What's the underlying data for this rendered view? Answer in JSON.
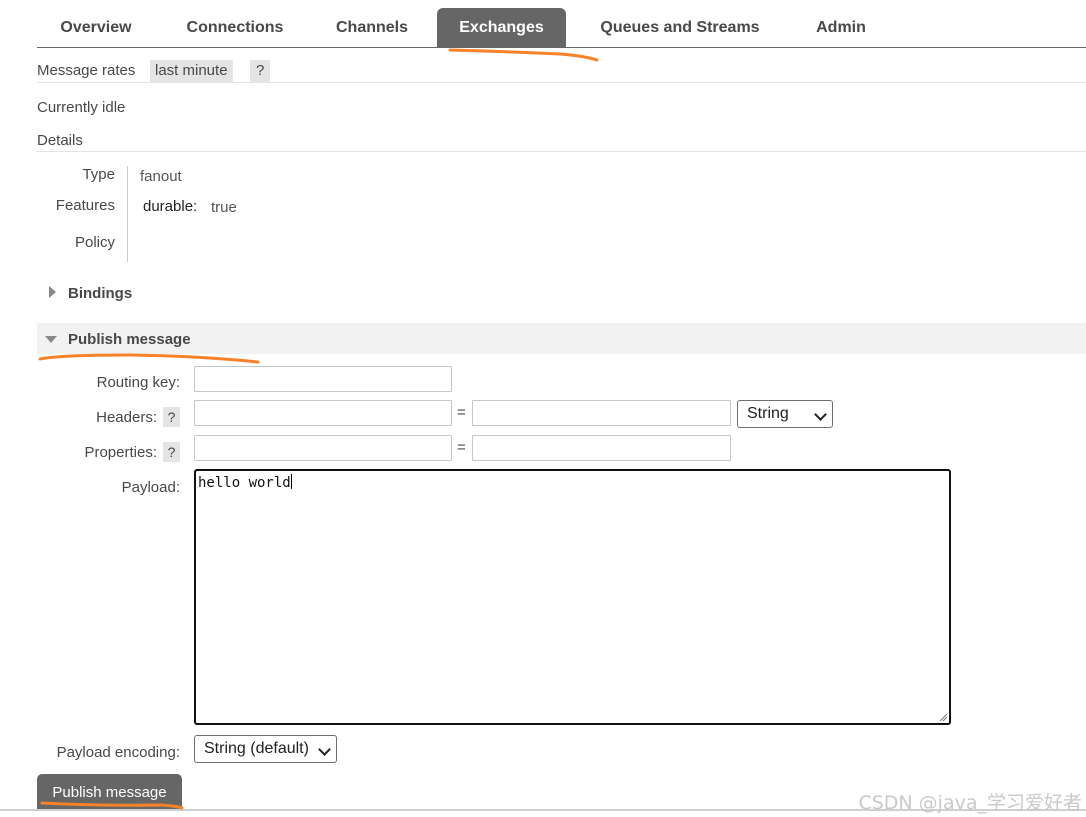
{
  "nav": {
    "tabs": [
      {
        "label": "Overview",
        "active": false
      },
      {
        "label": "Connections",
        "active": false
      },
      {
        "label": "Channels",
        "active": false
      },
      {
        "label": "Exchanges",
        "active": true
      },
      {
        "label": "Queues and Streams",
        "active": false
      },
      {
        "label": "Admin",
        "active": false
      }
    ]
  },
  "message_rates": {
    "label": "Message rates",
    "period": "last minute",
    "help": "?"
  },
  "status": {
    "text": "Currently idle"
  },
  "details": {
    "heading": "Details",
    "type_label": "Type",
    "type_value": "fanout",
    "features_label": "Features",
    "feature_key": "durable:",
    "feature_value": "true",
    "policy_label": "Policy"
  },
  "bindings": {
    "label": "Bindings",
    "expanded": false
  },
  "publish": {
    "label": "Publish message",
    "expanded": true,
    "routing_key_label": "Routing key:",
    "routing_key_value": "",
    "headers_label": "Headers:",
    "headers_help": "?",
    "headers_type": "String",
    "equals": "=",
    "properties_label": "Properties:",
    "properties_help": "?",
    "payload_label": "Payload:",
    "payload_value": "hello world",
    "encoding_label": "Payload encoding:",
    "encoding_value": "String (default)",
    "submit_label": "Publish message"
  },
  "watermark": "CSDN @java_学习爱好者",
  "colors": {
    "tab_active": "#666666",
    "annotation": "#f7822a"
  }
}
